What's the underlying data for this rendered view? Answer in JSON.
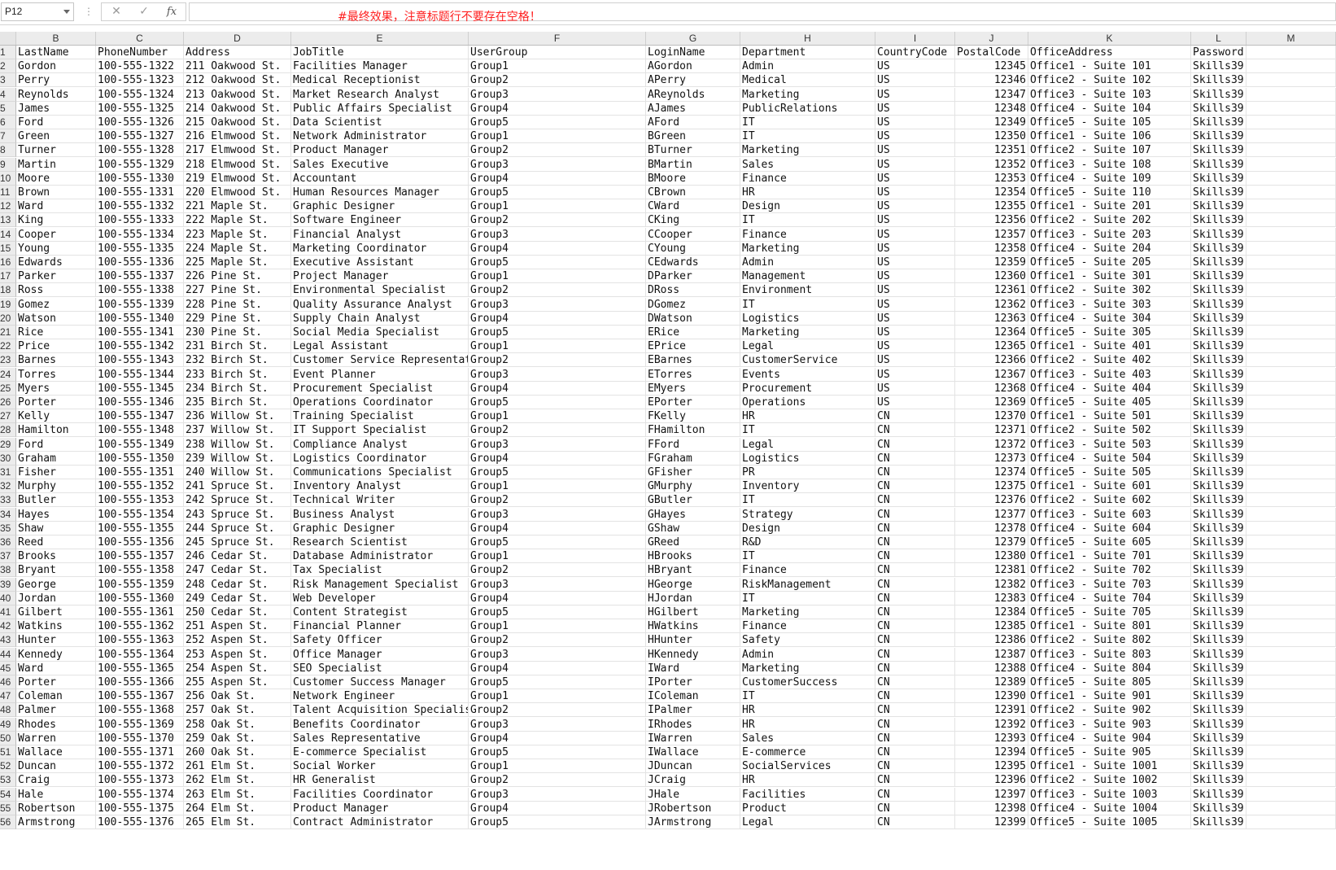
{
  "name_box": "P12",
  "formula_bar": {
    "cancel_icon": "cancel-icon",
    "enter_icon": "check-icon",
    "fx_label": "fx",
    "value": ""
  },
  "note": "#最终效果，注意标题行不要存在空格！",
  "columns": [
    "B",
    "C",
    "D",
    "E",
    "F",
    "G",
    "H",
    "I",
    "J",
    "K",
    "L",
    "M"
  ],
  "headers": [
    "LastName",
    "PhoneNumber",
    "Address",
    "JobTitle",
    "UserGroup",
    "LoginName",
    "Department",
    "CountryCode",
    "PostalCode",
    "OfficeAddress",
    "Password"
  ],
  "rows": [
    [
      "Gordon",
      "100-555-1322",
      "211 Oakwood St.",
      "Facilities Manager",
      "Group1",
      "AGordon",
      "Admin",
      "US",
      "12345",
      "Office1 - Suite 101",
      "Skills39"
    ],
    [
      "Perry",
      "100-555-1323",
      "212 Oakwood St.",
      "Medical Receptionist",
      "Group2",
      "APerry",
      "Medical",
      "US",
      "12346",
      "Office2 - Suite 102",
      "Skills39"
    ],
    [
      "Reynolds",
      "100-555-1324",
      "213 Oakwood St.",
      "Market Research Analyst",
      "Group3",
      "AReynolds",
      "Marketing",
      "US",
      "12347",
      "Office3 - Suite 103",
      "Skills39"
    ],
    [
      "James",
      "100-555-1325",
      "214 Oakwood St.",
      "Public Affairs Specialist",
      "Group4",
      "AJames",
      "PublicRelations",
      "US",
      "12348",
      "Office4 - Suite 104",
      "Skills39"
    ],
    [
      "Ford",
      "100-555-1326",
      "215 Oakwood St.",
      "Data Scientist",
      "Group5",
      "AFord",
      "IT",
      "US",
      "12349",
      "Office5 - Suite 105",
      "Skills39"
    ],
    [
      "Green",
      "100-555-1327",
      "216 Elmwood St.",
      "Network Administrator",
      "Group1",
      "BGreen",
      "IT",
      "US",
      "12350",
      "Office1 - Suite 106",
      "Skills39"
    ],
    [
      "Turner",
      "100-555-1328",
      "217 Elmwood St.",
      "Product Manager",
      "Group2",
      "BTurner",
      "Marketing",
      "US",
      "12351",
      "Office2 - Suite 107",
      "Skills39"
    ],
    [
      "Martin",
      "100-555-1329",
      "218 Elmwood St.",
      "Sales Executive",
      "Group3",
      "BMartin",
      "Sales",
      "US",
      "12352",
      "Office3 - Suite 108",
      "Skills39"
    ],
    [
      "Moore",
      "100-555-1330",
      "219 Elmwood St.",
      "Accountant",
      "Group4",
      "BMoore",
      "Finance",
      "US",
      "12353",
      "Office4 - Suite 109",
      "Skills39"
    ],
    [
      "Brown",
      "100-555-1331",
      "220 Elmwood St.",
      "Human Resources Manager",
      "Group5",
      "CBrown",
      "HR",
      "US",
      "12354",
      "Office5 - Suite 110",
      "Skills39"
    ],
    [
      "Ward",
      "100-555-1332",
      "221 Maple St.",
      "Graphic Designer",
      "Group1",
      "CWard",
      "Design",
      "US",
      "12355",
      "Office1 - Suite 201",
      "Skills39"
    ],
    [
      "King",
      "100-555-1333",
      "222 Maple St.",
      "Software Engineer",
      "Group2",
      "CKing",
      "IT",
      "US",
      "12356",
      "Office2 - Suite 202",
      "Skills39"
    ],
    [
      "Cooper",
      "100-555-1334",
      "223 Maple St.",
      "Financial Analyst",
      "Group3",
      "CCooper",
      "Finance",
      "US",
      "12357",
      "Office3 - Suite 203",
      "Skills39"
    ],
    [
      "Young",
      "100-555-1335",
      "224 Maple St.",
      "Marketing Coordinator",
      "Group4",
      "CYoung",
      "Marketing",
      "US",
      "12358",
      "Office4 - Suite 204",
      "Skills39"
    ],
    [
      "Edwards",
      "100-555-1336",
      "225 Maple St.",
      "Executive Assistant",
      "Group5",
      "CEdwards",
      "Admin",
      "US",
      "12359",
      "Office5 - Suite 205",
      "Skills39"
    ],
    [
      "Parker",
      "100-555-1337",
      "226 Pine St.",
      "Project Manager",
      "Group1",
      "DParker",
      "Management",
      "US",
      "12360",
      "Office1 - Suite 301",
      "Skills39"
    ],
    [
      "Ross",
      "100-555-1338",
      "227 Pine St.",
      "Environmental Specialist",
      "Group2",
      "DRoss",
      "Environment",
      "US",
      "12361",
      "Office2 - Suite 302",
      "Skills39"
    ],
    [
      "Gomez",
      "100-555-1339",
      "228 Pine St.",
      "Quality Assurance Analyst",
      "Group3",
      "DGomez",
      "IT",
      "US",
      "12362",
      "Office3 - Suite 303",
      "Skills39"
    ],
    [
      "Watson",
      "100-555-1340",
      "229 Pine St.",
      "Supply Chain Analyst",
      "Group4",
      "DWatson",
      "Logistics",
      "US",
      "12363",
      "Office4 - Suite 304",
      "Skills39"
    ],
    [
      "Rice",
      "100-555-1341",
      "230 Pine St.",
      "Social Media Specialist",
      "Group5",
      "ERice",
      "Marketing",
      "US",
      "12364",
      "Office5 - Suite 305",
      "Skills39"
    ],
    [
      "Price",
      "100-555-1342",
      "231 Birch St.",
      "Legal Assistant",
      "Group1",
      "EPrice",
      "Legal",
      "US",
      "12365",
      "Office1 - Suite 401",
      "Skills39"
    ],
    [
      "Barnes",
      "100-555-1343",
      "232 Birch St.",
      "Customer Service Representat",
      "Group2",
      "EBarnes",
      "CustomerService",
      "US",
      "12366",
      "Office2 - Suite 402",
      "Skills39"
    ],
    [
      "Torres",
      "100-555-1344",
      "233 Birch St.",
      "Event Planner",
      "Group3",
      "ETorres",
      "Events",
      "US",
      "12367",
      "Office3 - Suite 403",
      "Skills39"
    ],
    [
      "Myers",
      "100-555-1345",
      "234 Birch St.",
      "Procurement Specialist",
      "Group4",
      "EMyers",
      "Procurement",
      "US",
      "12368",
      "Office4 - Suite 404",
      "Skills39"
    ],
    [
      "Porter",
      "100-555-1346",
      "235 Birch St.",
      "Operations Coordinator",
      "Group5",
      "EPorter",
      "Operations",
      "US",
      "12369",
      "Office5 - Suite 405",
      "Skills39"
    ],
    [
      "Kelly",
      "100-555-1347",
      "236 Willow St.",
      "Training Specialist",
      "Group1",
      "FKelly",
      "HR",
      "CN",
      "12370",
      "Office1 - Suite 501",
      "Skills39"
    ],
    [
      "Hamilton",
      "100-555-1348",
      "237 Willow St.",
      "IT Support Specialist",
      "Group2",
      "FHamilton",
      "IT",
      "CN",
      "12371",
      "Office2 - Suite 502",
      "Skills39"
    ],
    [
      "Ford",
      "100-555-1349",
      "238 Willow St.",
      "Compliance Analyst",
      "Group3",
      "FFord",
      "Legal",
      "CN",
      "12372",
      "Office3 - Suite 503",
      "Skills39"
    ],
    [
      "Graham",
      "100-555-1350",
      "239 Willow St.",
      "Logistics Coordinator",
      "Group4",
      "FGraham",
      "Logistics",
      "CN",
      "12373",
      "Office4 - Suite 504",
      "Skills39"
    ],
    [
      "Fisher",
      "100-555-1351",
      "240 Willow St.",
      "Communications Specialist",
      "Group5",
      "GFisher",
      "PR",
      "CN",
      "12374",
      "Office5 - Suite 505",
      "Skills39"
    ],
    [
      "Murphy",
      "100-555-1352",
      "241 Spruce St.",
      "Inventory Analyst",
      "Group1",
      "GMurphy",
      "Inventory",
      "CN",
      "12375",
      "Office1 - Suite 601",
      "Skills39"
    ],
    [
      "Butler",
      "100-555-1353",
      "242 Spruce St.",
      "Technical Writer",
      "Group2",
      "GButler",
      "IT",
      "CN",
      "12376",
      "Office2 - Suite 602",
      "Skills39"
    ],
    [
      "Hayes",
      "100-555-1354",
      "243 Spruce St.",
      "Business Analyst",
      "Group3",
      "GHayes",
      "Strategy",
      "CN",
      "12377",
      "Office3 - Suite 603",
      "Skills39"
    ],
    [
      "Shaw",
      "100-555-1355",
      "244 Spruce St.",
      "Graphic Designer",
      "Group4",
      "GShaw",
      "Design",
      "CN",
      "12378",
      "Office4 - Suite 604",
      "Skills39"
    ],
    [
      "Reed",
      "100-555-1356",
      "245 Spruce St.",
      "Research Scientist",
      "Group5",
      "GReed",
      "R&D",
      "CN",
      "12379",
      "Office5 - Suite 605",
      "Skills39"
    ],
    [
      "Brooks",
      "100-555-1357",
      "246 Cedar St.",
      "Database Administrator",
      "Group1",
      "HBrooks",
      "IT",
      "CN",
      "12380",
      "Office1 - Suite 701",
      "Skills39"
    ],
    [
      "Bryant",
      "100-555-1358",
      "247 Cedar St.",
      "Tax Specialist",
      "Group2",
      "HBryant",
      "Finance",
      "CN",
      "12381",
      "Office2 - Suite 702",
      "Skills39"
    ],
    [
      "George",
      "100-555-1359",
      "248 Cedar St.",
      "Risk Management Specialist",
      "Group3",
      "HGeorge",
      "RiskManagement",
      "CN",
      "12382",
      "Office3 - Suite 703",
      "Skills39"
    ],
    [
      "Jordan",
      "100-555-1360",
      "249 Cedar St.",
      "Web Developer",
      "Group4",
      "HJordan",
      "IT",
      "CN",
      "12383",
      "Office4 - Suite 704",
      "Skills39"
    ],
    [
      "Gilbert",
      "100-555-1361",
      "250 Cedar St.",
      "Content Strategist",
      "Group5",
      "HGilbert",
      "Marketing",
      "CN",
      "12384",
      "Office5 - Suite 705",
      "Skills39"
    ],
    [
      "Watkins",
      "100-555-1362",
      "251 Aspen St.",
      "Financial Planner",
      "Group1",
      "HWatkins",
      "Finance",
      "CN",
      "12385",
      "Office1 - Suite 801",
      "Skills39"
    ],
    [
      "Hunter",
      "100-555-1363",
      "252 Aspen St.",
      "Safety Officer",
      "Group2",
      "HHunter",
      "Safety",
      "CN",
      "12386",
      "Office2 - Suite 802",
      "Skills39"
    ],
    [
      "Kennedy",
      "100-555-1364",
      "253 Aspen St.",
      "Office Manager",
      "Group3",
      "HKennedy",
      "Admin",
      "CN",
      "12387",
      "Office3 - Suite 803",
      "Skills39"
    ],
    [
      "Ward",
      "100-555-1365",
      "254 Aspen St.",
      "SEO Specialist",
      "Group4",
      "IWard",
      "Marketing",
      "CN",
      "12388",
      "Office4 - Suite 804",
      "Skills39"
    ],
    [
      "Porter",
      "100-555-1366",
      "255 Aspen St.",
      "Customer Success Manager",
      "Group5",
      "IPorter",
      "CustomerSuccess",
      "CN",
      "12389",
      "Office5 - Suite 805",
      "Skills39"
    ],
    [
      "Coleman",
      "100-555-1367",
      "256 Oak St.",
      "Network Engineer",
      "Group1",
      "IColeman",
      "IT",
      "CN",
      "12390",
      "Office1 - Suite 901",
      "Skills39"
    ],
    [
      "Palmer",
      "100-555-1368",
      "257 Oak St.",
      "Talent Acquisition Specialis",
      "Group2",
      "IPalmer",
      "HR",
      "CN",
      "12391",
      "Office2 - Suite 902",
      "Skills39"
    ],
    [
      "Rhodes",
      "100-555-1369",
      "258 Oak St.",
      "Benefits Coordinator",
      "Group3",
      "IRhodes",
      "HR",
      "CN",
      "12392",
      "Office3 - Suite 903",
      "Skills39"
    ],
    [
      "Warren",
      "100-555-1370",
      "259 Oak St.",
      "Sales Representative",
      "Group4",
      "IWarren",
      "Sales",
      "CN",
      "12393",
      "Office4 - Suite 904",
      "Skills39"
    ],
    [
      "Wallace",
      "100-555-1371",
      "260 Oak St.",
      "E-commerce Specialist",
      "Group5",
      "IWallace",
      "E-commerce",
      "CN",
      "12394",
      "Office5 - Suite 905",
      "Skills39"
    ],
    [
      "Duncan",
      "100-555-1372",
      "261 Elm St.",
      "Social Worker",
      "Group1",
      "JDuncan",
      "SocialServices",
      "CN",
      "12395",
      "Office1 - Suite 1001",
      "Skills39"
    ],
    [
      "Craig",
      "100-555-1373",
      "262 Elm St.",
      "HR Generalist",
      "Group2",
      "JCraig",
      "HR",
      "CN",
      "12396",
      "Office2 - Suite 1002",
      "Skills39"
    ],
    [
      "Hale",
      "100-555-1374",
      "263 Elm St.",
      "Facilities Coordinator",
      "Group3",
      "JHale",
      "Facilities",
      "CN",
      "12397",
      "Office3 - Suite 1003",
      "Skills39"
    ],
    [
      "Robertson",
      "100-555-1375",
      "264 Elm St.",
      "Product Manager",
      "Group4",
      "JRobertson",
      "Product",
      "CN",
      "12398",
      "Office4 - Suite 1004",
      "Skills39"
    ],
    [
      "Armstrong",
      "100-555-1376",
      "265 Elm St.",
      "Contract Administrator",
      "Group5",
      "JArmstrong",
      "Legal",
      "CN",
      "12399",
      "Office5 - Suite 1005",
      "Skills39"
    ]
  ]
}
